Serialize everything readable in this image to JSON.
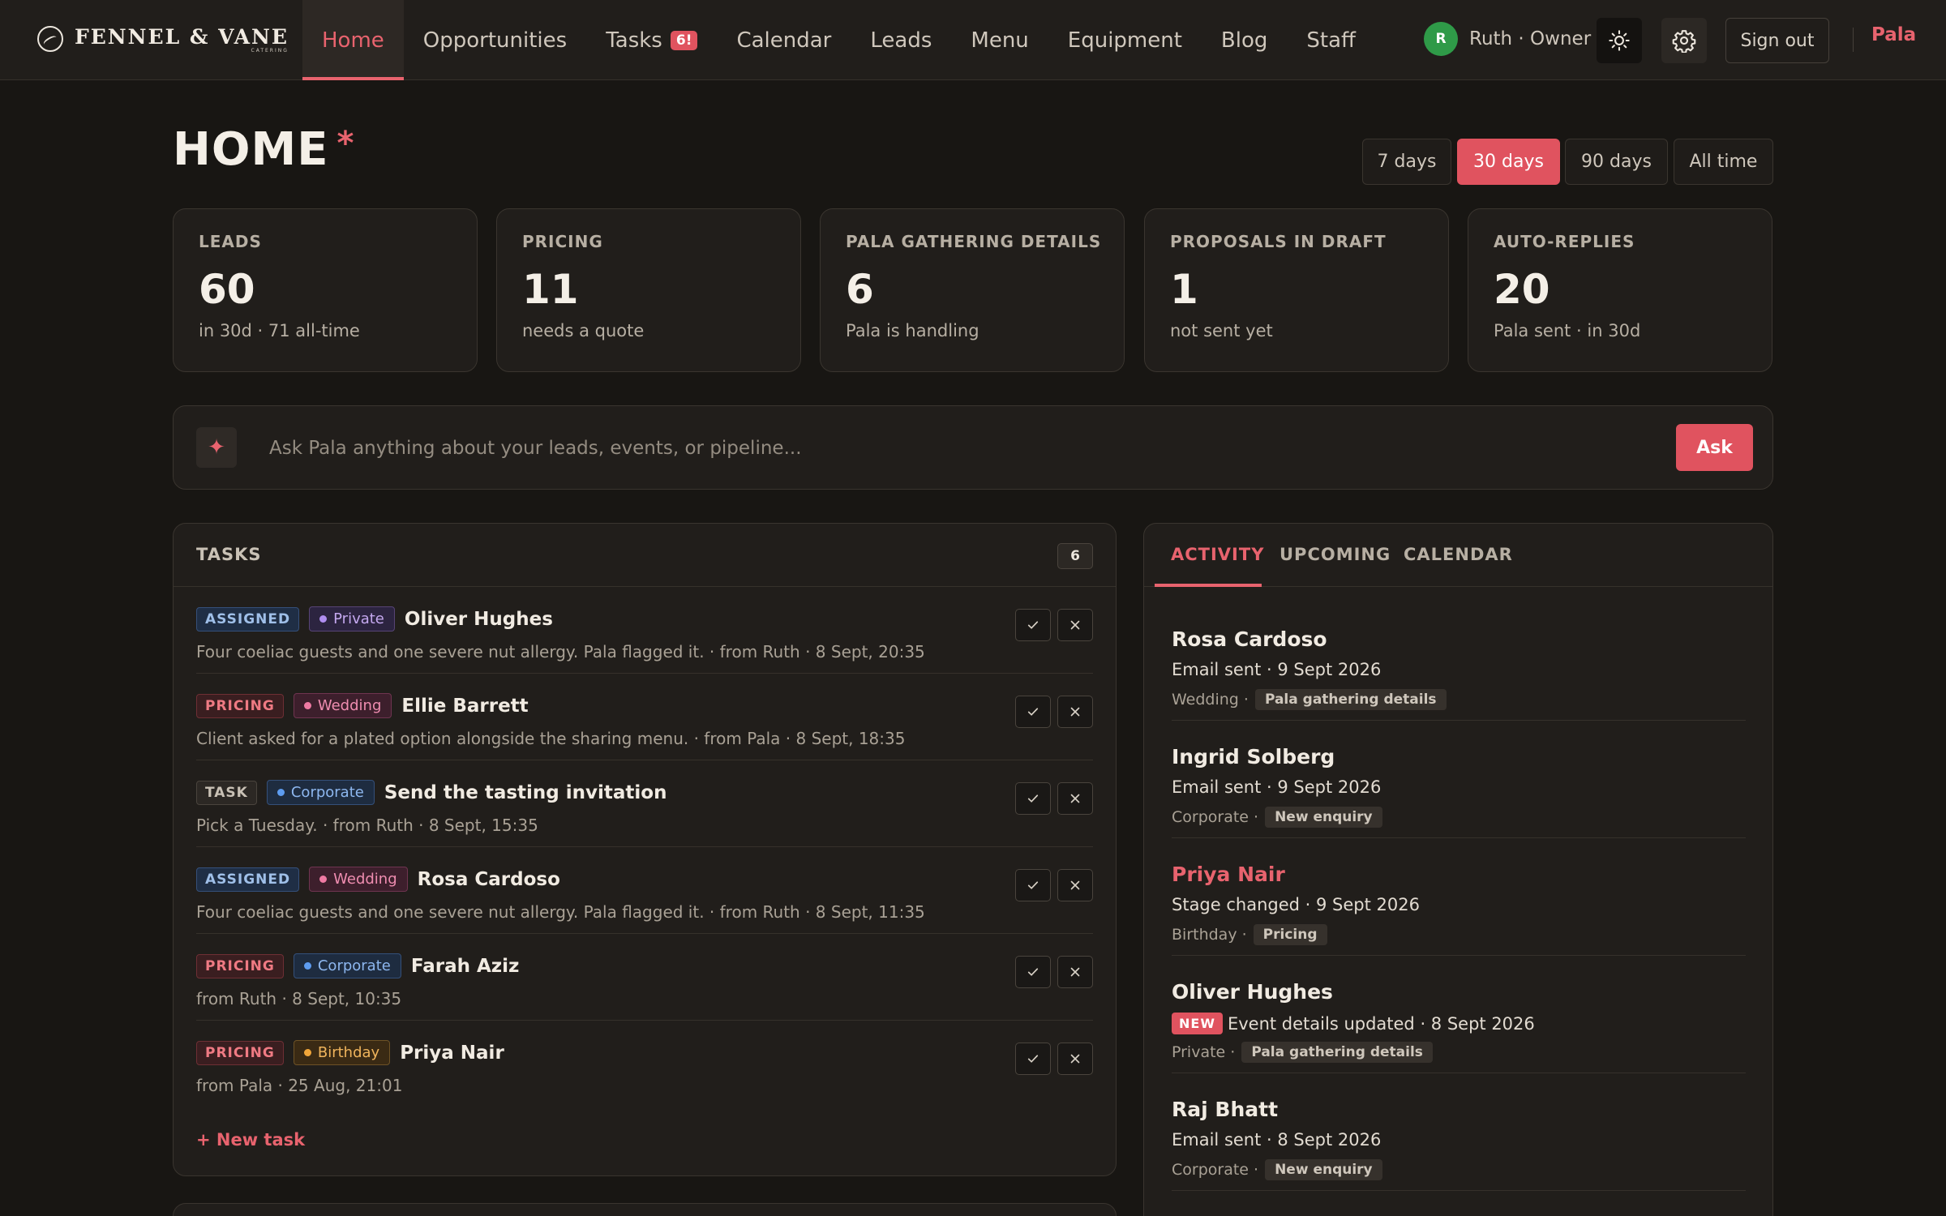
{
  "brand": {
    "name": "FENNEL & VANE",
    "sub": "CATERING"
  },
  "nav": [
    {
      "label": "Home",
      "active": true
    },
    {
      "label": "Opportunities"
    },
    {
      "label": "Tasks",
      "badge": "6!"
    },
    {
      "label": "Calendar"
    },
    {
      "label": "Leads"
    },
    {
      "label": "Menu"
    },
    {
      "label": "Equipment"
    },
    {
      "label": "Blog"
    },
    {
      "label": "Staff"
    }
  ],
  "user": {
    "initial": "R",
    "name": "Ruth · Owner",
    "avatar_color": "#2f9a48"
  },
  "header": {
    "sign_out": "Sign out",
    "assistant_link": "Pala",
    "sun_icon": "sun-icon",
    "gear_icon": "gear-icon"
  },
  "page": {
    "title": "HOME",
    "marker": "*"
  },
  "ranges": [
    "7 days",
    "30 days",
    "90 days",
    "All time"
  ],
  "ranges_active": "30 days",
  "stats": [
    {
      "label": "LEADS",
      "value": "60",
      "sub": "in 30d · 71 all-time"
    },
    {
      "label": "PRICING",
      "value": "11",
      "sub": "needs a quote"
    },
    {
      "label": "PALA GATHERING DETAILS",
      "value": "6",
      "sub": "Pala is handling"
    },
    {
      "label": "PROPOSALS IN DRAFT",
      "value": "1",
      "sub": "not sent yet"
    },
    {
      "label": "AUTO-REPLIES",
      "value": "20",
      "sub": "Pala sent · in 30d"
    }
  ],
  "ask": {
    "icon": "sparkle-icon",
    "glyph": "✦",
    "placeholder": "Ask Pala anything about your leads, events, or pipeline...",
    "button": "Ask"
  },
  "tasks": {
    "title": "TASKS",
    "count": "6",
    "items": [
      {
        "tag": "ASSIGNED",
        "tag_type": "assigned",
        "category": "Private",
        "cat_type": "private",
        "title": "Oliver Hughes",
        "sub": "Four coeliac guests and one severe nut allergy. Pala flagged it. · from Ruth · 8 Sept, 20:35"
      },
      {
        "tag": "PRICING",
        "tag_type": "pricing",
        "category": "Wedding",
        "cat_type": "wedding",
        "title": "Ellie Barrett",
        "sub": "Client asked for a plated option alongside the sharing menu. · from Pala · 8 Sept, 18:35"
      },
      {
        "tag": "TASK",
        "tag_type": "task",
        "category": "Corporate",
        "cat_type": "corporate",
        "title": "Send the tasting invitation",
        "sub": "Pick a Tuesday. · from Ruth · 8 Sept, 15:35"
      },
      {
        "tag": "ASSIGNED",
        "tag_type": "assigned",
        "category": "Wedding",
        "cat_type": "wedding",
        "title": "Rosa Cardoso",
        "sub": "Four coeliac guests and one severe nut allergy. Pala flagged it. · from Ruth · 8 Sept, 11:35"
      },
      {
        "tag": "PRICING",
        "tag_type": "pricing",
        "category": "Corporate",
        "cat_type": "corporate",
        "title": "Farah Aziz",
        "sub": "from Ruth · 8 Sept, 10:35"
      },
      {
        "tag": "PRICING",
        "tag_type": "pricing",
        "category": "Birthday",
        "cat_type": "birthday",
        "title": "Priya Nair",
        "sub": "from Pala · 25 Aug, 21:01"
      }
    ],
    "new_task": "+ New task"
  },
  "activity": {
    "tabs": [
      "ACTIVITY",
      "UPCOMING",
      "CALENDAR"
    ],
    "active_tab": "ACTIVITY",
    "items": [
      {
        "name": "Rosa Cardoso",
        "desc": "Email sent · 9 Sept 2026",
        "category": "Wedding ·",
        "stage": "Pala gathering details"
      },
      {
        "name": "Ingrid Solberg",
        "desc": "Email sent · 9 Sept 2026",
        "category": "Corporate ·",
        "stage": "New enquiry"
      },
      {
        "name": "Priya Nair",
        "desc": "Stage changed · 9 Sept 2026",
        "category": "Birthday ·",
        "stage": "Pricing",
        "highlight": true
      },
      {
        "name": "Oliver Hughes",
        "badge": "NEW",
        "desc": "Event details updated · 8 Sept 2026",
        "category": "Private ·",
        "stage": "Pala gathering details"
      },
      {
        "name": "Raj Bhatt",
        "desc": "Email sent · 8 Sept 2026",
        "category": "Corporate ·",
        "stage": "New enquiry"
      }
    ]
  },
  "colors": {
    "accent": "#e0535f",
    "background": "#181613",
    "panel": "#211e1b"
  }
}
